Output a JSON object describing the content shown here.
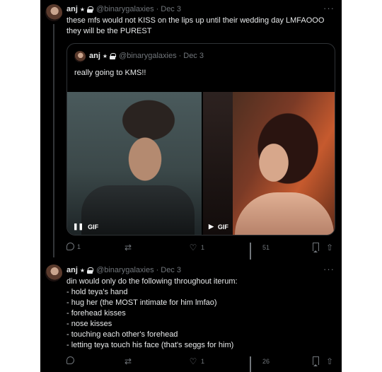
{
  "tweets": [
    {
      "author": "anj",
      "badge": "★",
      "handle": "@binarygalaxies",
      "date": "Dec 3",
      "text": "these mfs would not KISS on the lips up until their wedding day LMFAOOO\nthey will be the PUREST",
      "quote": {
        "author": "anj",
        "badge": "★",
        "handle": "@binarygalaxies",
        "date": "Dec 3",
        "text": "really going to KMS!!",
        "media": [
          {
            "type": "GIF",
            "control": "pause",
            "label": "GIF"
          },
          {
            "type": "GIF",
            "control": "play",
            "label": "GIF"
          }
        ]
      },
      "stats": {
        "replies": "1",
        "retweets": "",
        "likes": "1",
        "views": "51"
      }
    },
    {
      "author": "anj",
      "badge": "★",
      "handle": "@binarygalaxies",
      "date": "Dec 3",
      "text": "din would only do the following throughout iterum:\n- hold teya's hand\n- hug her (the MOST intimate for him lmfao)\n- forehead kisses\n- nose kisses\n- touching each other's forehead\n- letting teya touch his face (that's seggs for him)",
      "stats": {
        "replies": "",
        "retweets": "",
        "likes": "1",
        "views": "26"
      }
    }
  ],
  "ui": {
    "dot": "·",
    "more": "···"
  },
  "colors": {
    "background": "#000000",
    "text": "#e7e9ea",
    "muted": "#71767b",
    "border": "#2f3336"
  }
}
